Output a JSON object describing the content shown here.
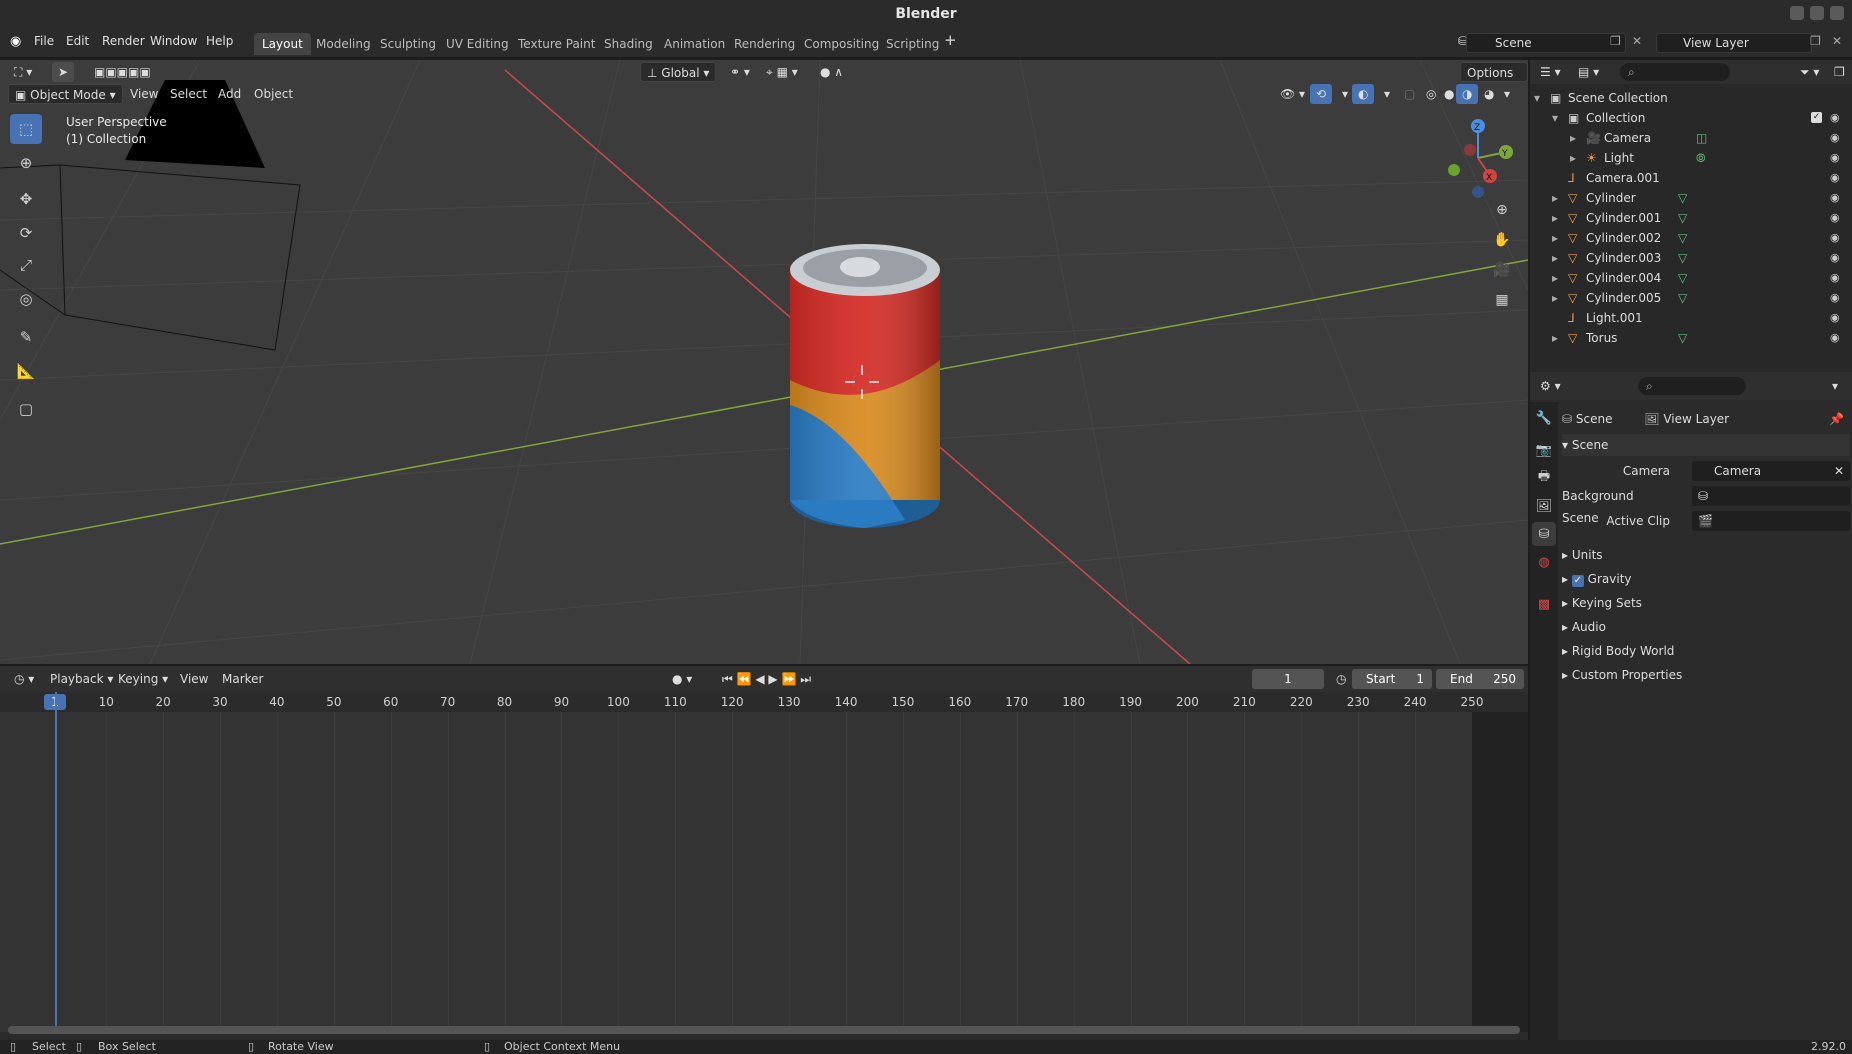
{
  "window": {
    "title": "Blender"
  },
  "menu": {
    "file": "File",
    "edit": "Edit",
    "render": "Render",
    "window": "Window",
    "help": "Help"
  },
  "workspaces": [
    "Layout",
    "Modeling",
    "Sculpting",
    "UV Editing",
    "Texture Paint",
    "Shading",
    "Animation",
    "Rendering",
    "Compositing",
    "Scripting"
  ],
  "scene_field": "Scene",
  "view_layer_field": "View Layer",
  "viewport": {
    "mode": "Object Mode",
    "menus": {
      "view": "View",
      "select": "Select",
      "add": "Add",
      "object": "Object"
    },
    "orientation": "Global",
    "options": "Options",
    "overlay_line1": "User Perspective",
    "overlay_line2": "(1) Collection",
    "gizmo": {
      "x": "X",
      "y": "Y",
      "z": "Z"
    }
  },
  "timeline": {
    "playback": "Playback",
    "keying": "Keying",
    "view": "View",
    "marker": "Marker",
    "current_frame": "1",
    "start_label": "Start",
    "start_value": "1",
    "end_label": "End",
    "end_value": "250",
    "ruler_current": "1",
    "ticks": [
      "10",
      "20",
      "30",
      "40",
      "50",
      "60",
      "70",
      "80",
      "90",
      "100",
      "110",
      "120",
      "130",
      "140",
      "150",
      "160",
      "170",
      "180",
      "190",
      "200",
      "210",
      "220",
      "230",
      "240",
      "250"
    ]
  },
  "outliner": {
    "root": "Scene Collection",
    "items": [
      {
        "label": "Collection",
        "icon": "collection-icon"
      },
      {
        "label": "Camera",
        "icon": "camera-icon"
      },
      {
        "label": "Light",
        "icon": "light-icon"
      },
      {
        "label": "Camera.001",
        "icon": "object-icon"
      },
      {
        "label": "Cylinder",
        "icon": "mesh-icon"
      },
      {
        "label": "Cylinder.001",
        "icon": "mesh-icon"
      },
      {
        "label": "Cylinder.002",
        "icon": "mesh-icon"
      },
      {
        "label": "Cylinder.003",
        "icon": "mesh-icon"
      },
      {
        "label": "Cylinder.004",
        "icon": "mesh-icon"
      },
      {
        "label": "Cylinder.005",
        "icon": "mesh-icon"
      },
      {
        "label": "Light.001",
        "icon": "object-icon"
      },
      {
        "label": "Torus",
        "icon": "mesh-icon"
      }
    ]
  },
  "properties": {
    "breadcrumb_scene": "Scene",
    "breadcrumb_viewlayer": "View Layer",
    "panel_title": "Scene",
    "camera_label": "Camera",
    "camera_value": "Camera",
    "background_scene_label": "Background Scene",
    "active_clip_label": "Active Clip",
    "sections": [
      "Units",
      "Gravity",
      "Keying Sets",
      "Audio",
      "Rigid Body World",
      "Custom Properties"
    ]
  },
  "status": {
    "select": "Select",
    "box_select": "Box Select",
    "rotate_view": "Rotate View",
    "context_menu": "Object Context Menu",
    "version": "2.92.0"
  },
  "colors": {
    "accent": "#4772b3",
    "can_red": "#d42a24",
    "can_orange": "#d88a1d",
    "can_blue": "#2b7bc3",
    "axis_red": "#c94a4a",
    "axis_green": "#7fa63a"
  }
}
